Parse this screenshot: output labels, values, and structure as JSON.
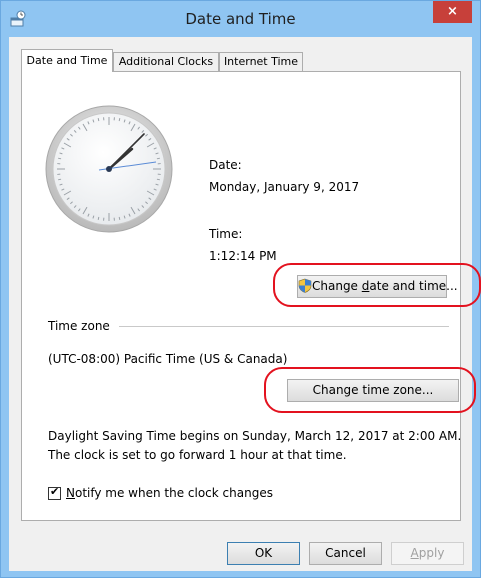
{
  "window": {
    "title": "Date and Time",
    "close_glyph": "×"
  },
  "tabs": [
    {
      "label": "Date and Time",
      "active": true
    },
    {
      "label": "Additional Clocks",
      "active": false
    },
    {
      "label": "Internet Time",
      "active": false
    }
  ],
  "date": {
    "label": "Date:",
    "value": "Monday, January 9, 2017"
  },
  "time": {
    "label": "Time:",
    "value": "1:12:14 PM"
  },
  "change_datetime": {
    "pre": "Change ",
    "accel": "d",
    "post": "ate and time..."
  },
  "timezone": {
    "group_label": "Time zone",
    "value": "(UTC-08:00) Pacific Time (US & Canada)",
    "button_label": "Change time zone..."
  },
  "dst": {
    "line1": "Daylight Saving Time begins on Sunday, March 12, 2017 at 2:00 AM.",
    "line2": "The clock is set to go forward 1 hour at that time."
  },
  "notify": {
    "accel": "N",
    "rest": "otify me when the clock changes",
    "checked": true,
    "check_glyph": "✔"
  },
  "buttons": {
    "ok": "OK",
    "cancel": "Cancel",
    "apply_accel": "A",
    "apply_rest": "pply"
  },
  "colors": {
    "highlight": "#e3121f",
    "titlebar": "#8fc5f2",
    "close": "#c7403a"
  },
  "icons": {
    "title": "date-time-icon",
    "shield": "uac-shield-icon"
  }
}
